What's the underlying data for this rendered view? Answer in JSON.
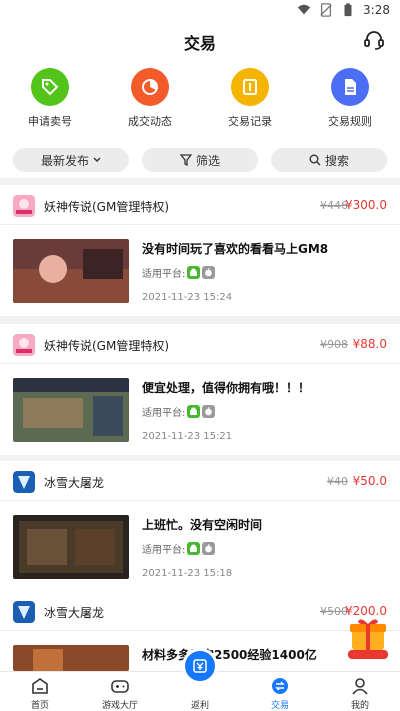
{
  "statusbar": {
    "time": "3:28"
  },
  "header": {
    "title": "交易"
  },
  "quicknav": [
    {
      "label": "申请卖号",
      "icon": "tag-icon",
      "color": "#52c41a"
    },
    {
      "label": "成交动态",
      "icon": "chart-icon",
      "color": "#f45b2a"
    },
    {
      "label": "交易记录",
      "icon": "record-icon",
      "color": "#f5b400"
    },
    {
      "label": "交易规则",
      "icon": "rules-icon",
      "color": "#4c6ef5"
    }
  ],
  "filters": {
    "sort": "最新发布",
    "filter": "筛选",
    "search": "搜索"
  },
  "platform_label": "适用平台:",
  "listings": [
    {
      "game": "妖神传说(GM管理特权)",
      "old_price": "¥446",
      "price": "¥300.0",
      "title": "没有时间玩了喜欢的看看马上GM8",
      "time": "2021-11-23 15:24"
    },
    {
      "game": "妖神传说(GM管理特权)",
      "old_price": "¥908",
      "price": "¥88.0",
      "title": "便宜处理，值得你拥有哦！！！",
      "time": "2021-11-23 15:21"
    },
    {
      "game": "冰雪大屠龙",
      "old_price": "¥40",
      "price": "¥50.0",
      "title": "上班忙。没有空闲时间",
      "time": "2021-11-23 15:18"
    },
    {
      "game": "冰雪大屠龙",
      "old_price": "¥500",
      "price": "¥200.0",
      "title": "材料多多元宝2500经验1400亿",
      "time": ""
    }
  ],
  "tabbar": [
    {
      "label": "首页"
    },
    {
      "label": "游戏大厅"
    },
    {
      "label": "返利"
    },
    {
      "label": "交易"
    },
    {
      "label": "我的"
    }
  ],
  "colors": {
    "accent": "#1677ff",
    "price": "#e8382f"
  }
}
